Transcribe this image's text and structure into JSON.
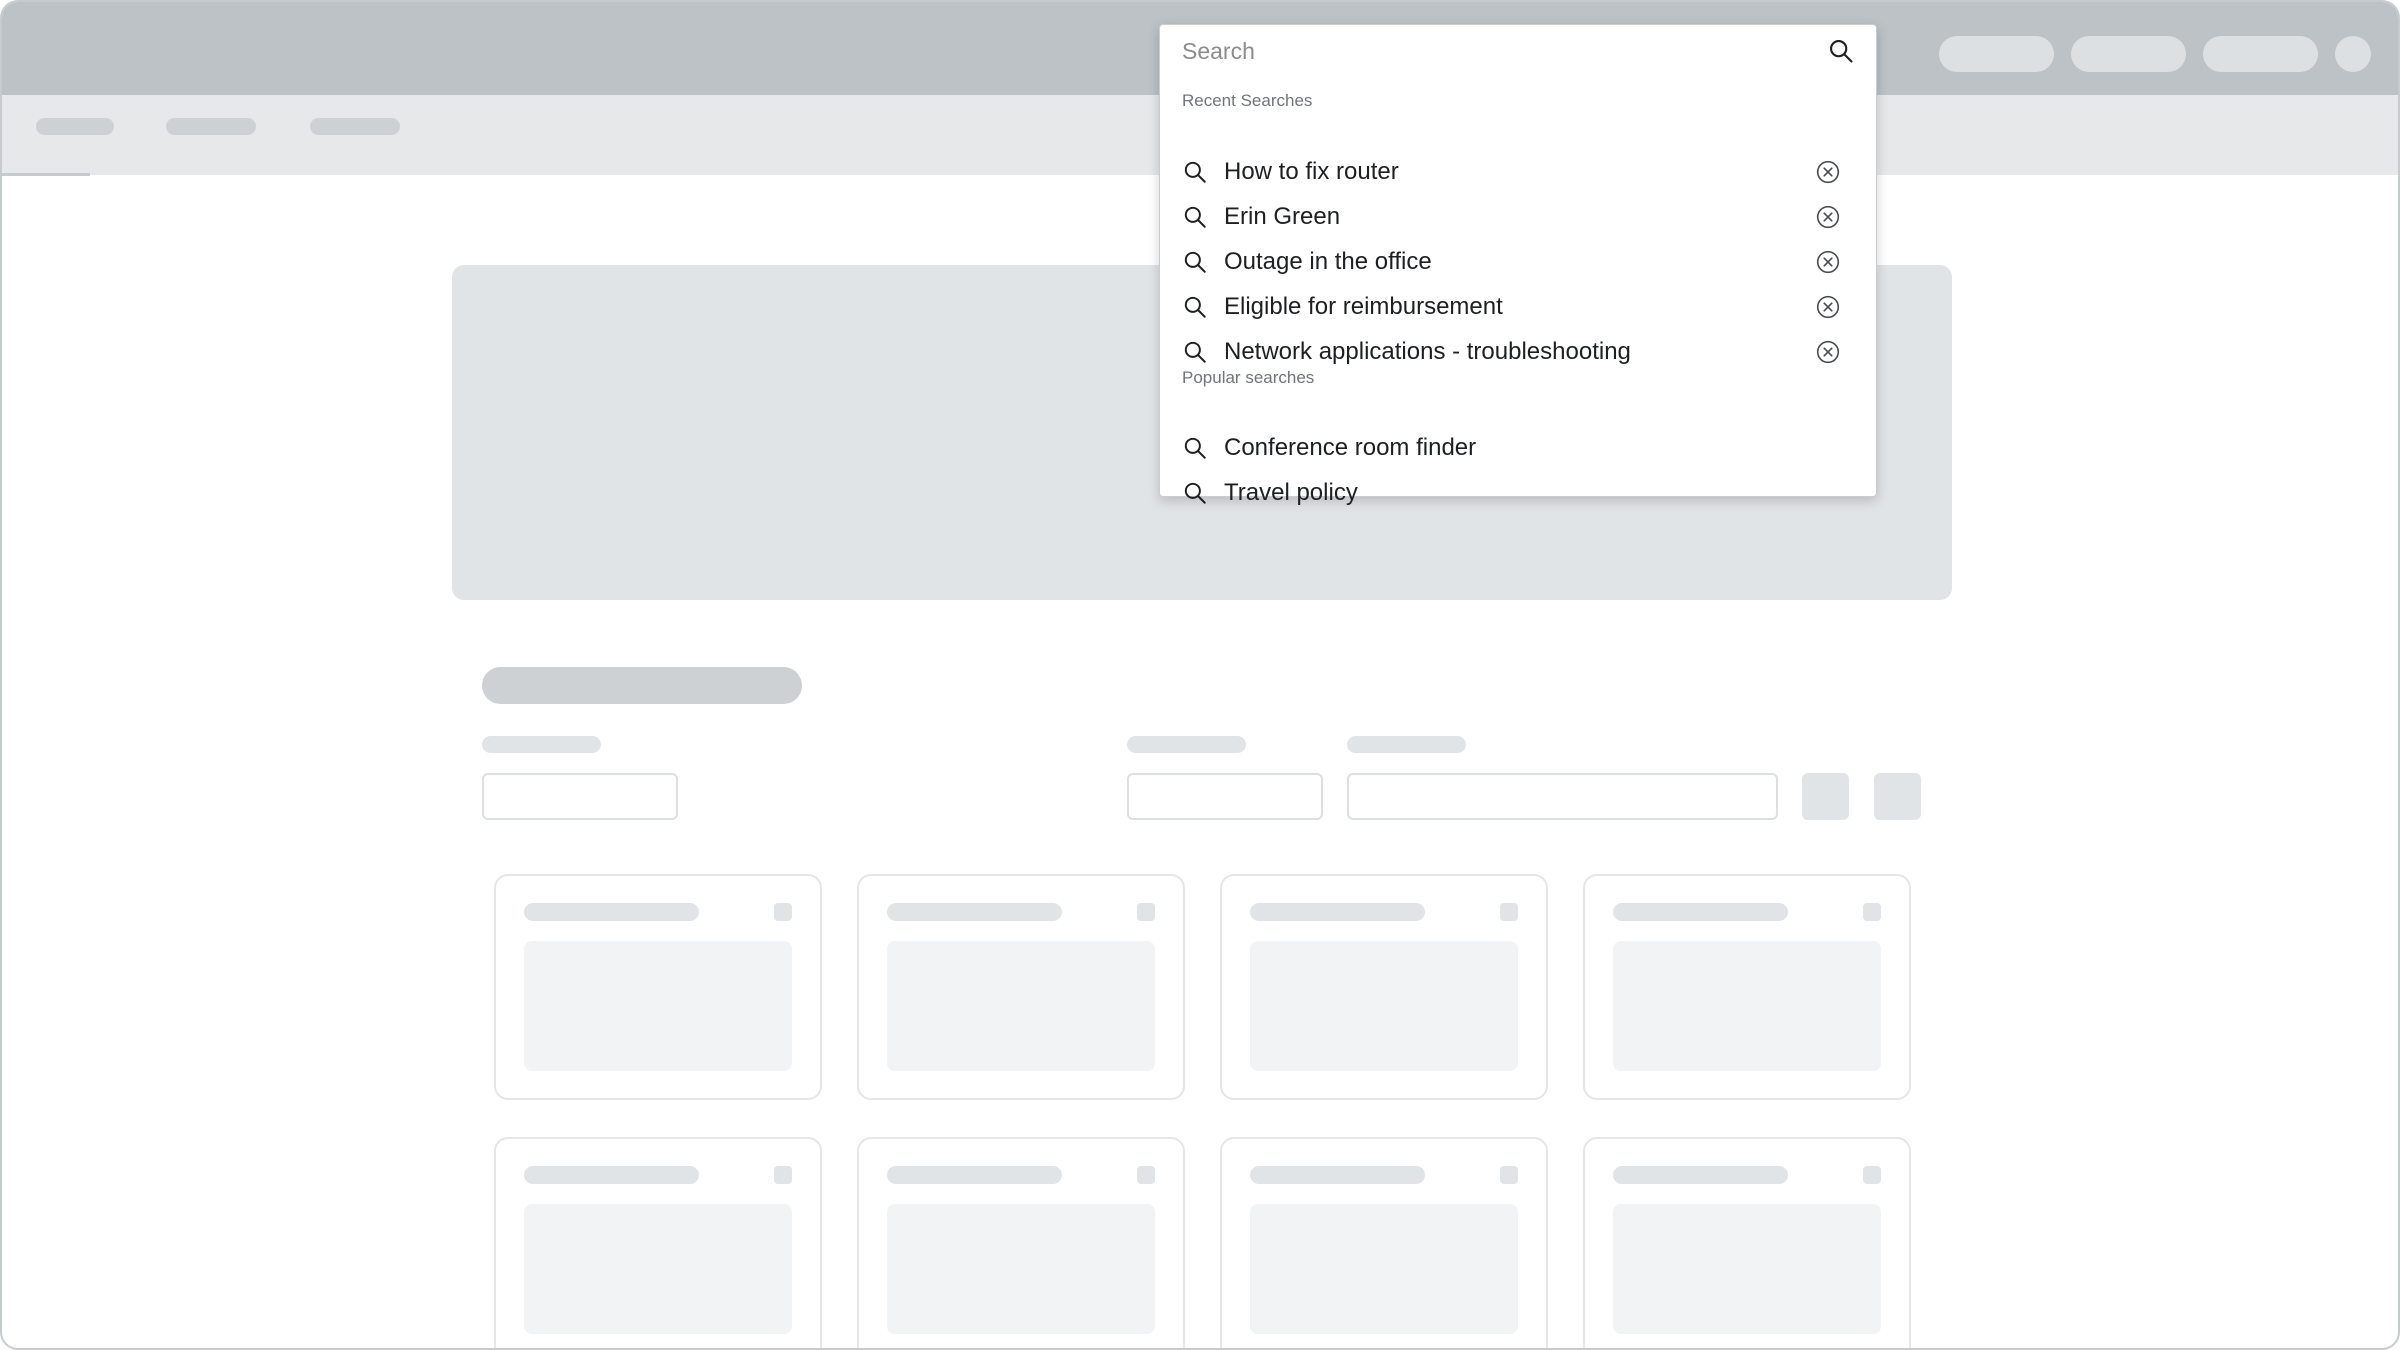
{
  "colors": {
    "topbar": "#bcc2c6",
    "subnav": "#e6e8ea",
    "skeleton": "#e1e4e6",
    "panel_border": "#c9cdd0",
    "text": "#1d1f21",
    "muted": "#707579"
  },
  "search": {
    "placeholder": "Search",
    "value": "",
    "submit_icon": "search-icon",
    "recent_label": "Recent Searches",
    "recent": [
      {
        "text": "How to fix router",
        "icon": "search-icon",
        "action_icon": "clear-circle-icon"
      },
      {
        "text": "Erin Green",
        "icon": "search-icon",
        "action_icon": "clear-circle-icon"
      },
      {
        "text": "Outage in the office",
        "icon": "search-icon",
        "action_icon": "clear-circle-icon"
      },
      {
        "text": "Eligible for reimbursement",
        "icon": "search-icon",
        "action_icon": "clear-circle-icon"
      },
      {
        "text": "Network applications - troubleshooting",
        "icon": "search-icon",
        "action_icon": "clear-circle-icon"
      }
    ],
    "popular_label": "Popular searches",
    "popular": [
      {
        "text": "Conference room finder",
        "icon": "search-icon"
      },
      {
        "text": "Travel policy",
        "icon": "search-icon"
      }
    ]
  }
}
